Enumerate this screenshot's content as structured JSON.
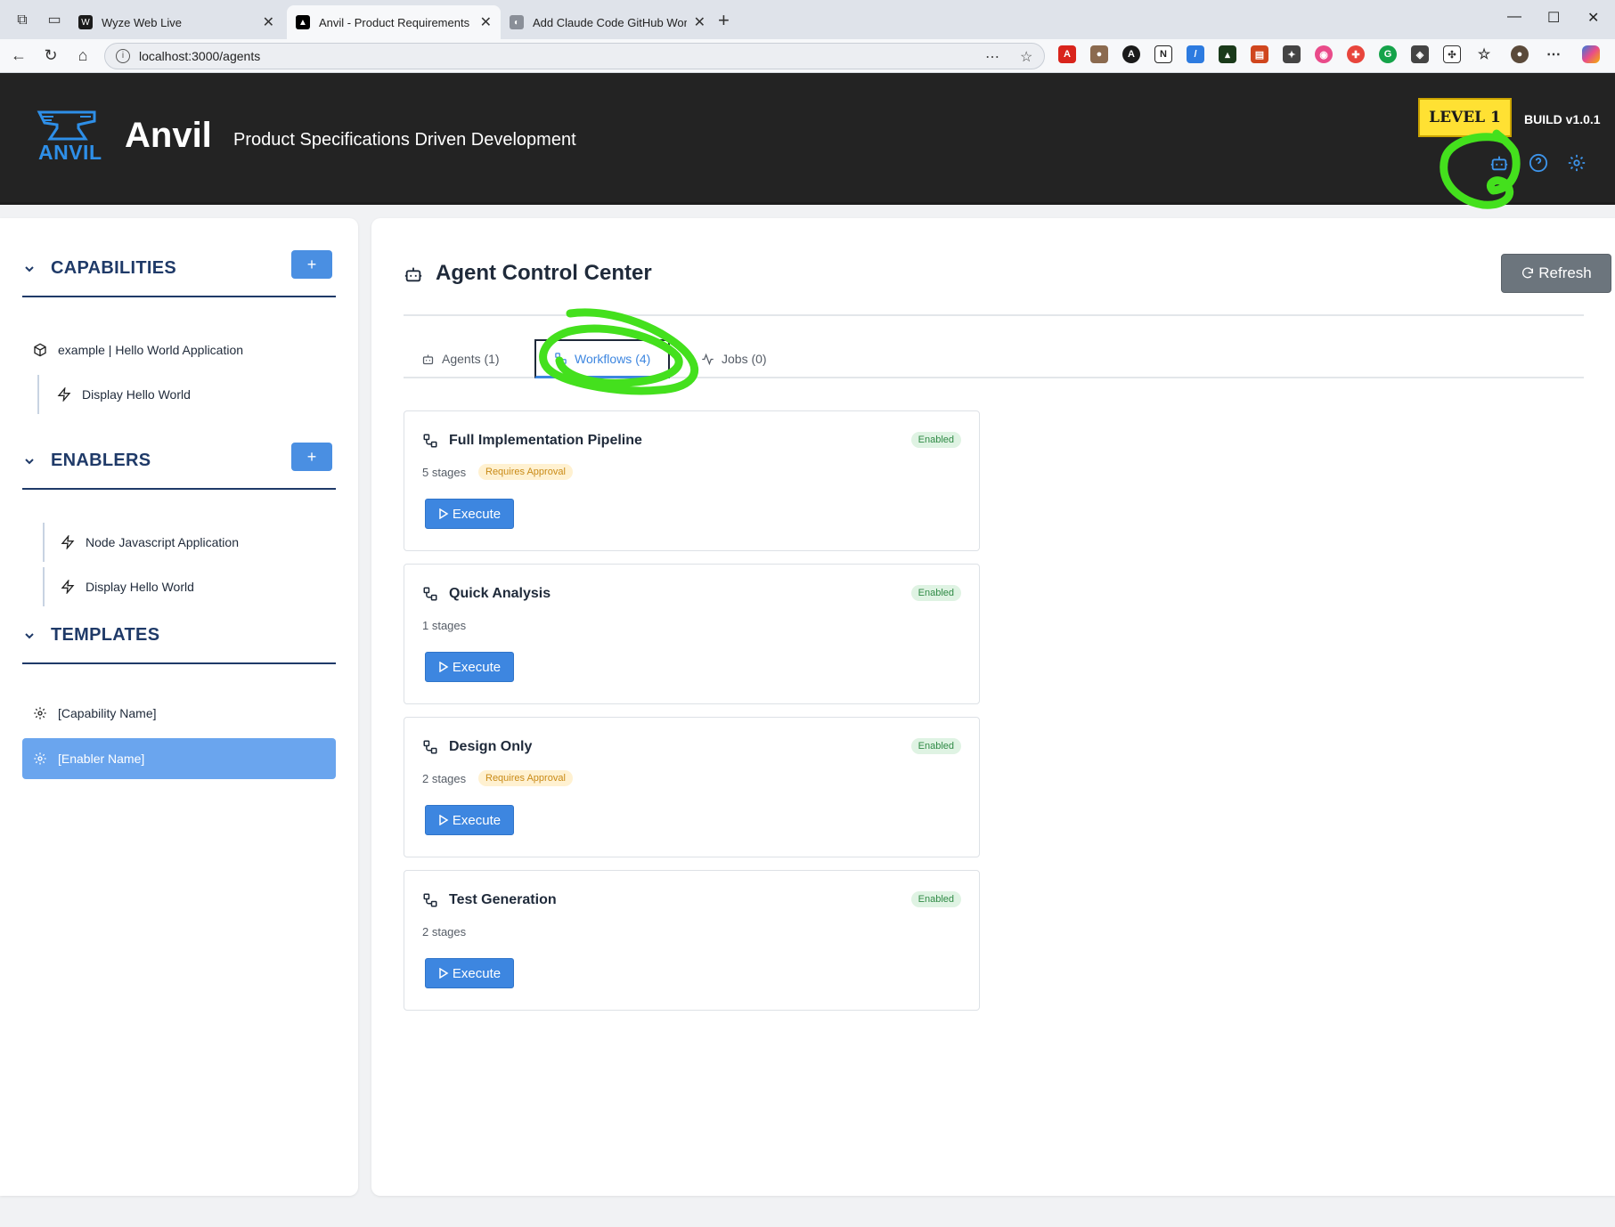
{
  "browser": {
    "tabs": [
      {
        "title": "Wyze Web Live",
        "favicon": "W",
        "color": "#1b1b1b"
      },
      {
        "title": "Anvil - Product Requirements Ma",
        "favicon": "▲",
        "color": "#000000"
      },
      {
        "title": "Add Claude Code GitHub Workflo",
        "favicon": "◐",
        "color": "#8a8f98"
      }
    ],
    "url": "localhost:3000/agents"
  },
  "header": {
    "logo_text": "ANVIL",
    "title": "Anvil",
    "subtitle": "Product Specifications Driven Development",
    "level": "LEVEL 1",
    "build": "BUILD v1.0.1",
    "accent": "#3d94ea",
    "level_color": "#ffe133"
  },
  "sidebar": {
    "capabilities": {
      "title": "CAPABILITIES",
      "add": "+",
      "items": [
        "example | Hello World Application",
        "Display Hello World"
      ]
    },
    "enablers": {
      "title": "ENABLERS",
      "add": "+",
      "items": [
        "Node Javascript Application",
        "Display Hello World"
      ]
    },
    "templates": {
      "title": "TEMPLATES",
      "items": [
        "[Capability Name]",
        "[Enabler Name]"
      ]
    }
  },
  "main": {
    "title": "Agent Control Center",
    "refresh": "Refresh",
    "tabs": [
      {
        "label": "Agents (1)",
        "icon": "robot-icon"
      },
      {
        "label": "Workflows (4)",
        "icon": "workflow-icon"
      },
      {
        "label": "Jobs (0)",
        "icon": "activity-icon"
      }
    ],
    "workflows": [
      {
        "name": "Full Implementation Pipeline",
        "status": "Enabled",
        "stages": "5 stages",
        "approval": "Requires Approval",
        "action": "Execute"
      },
      {
        "name": "Quick Analysis",
        "status": "Enabled",
        "stages": "1 stages",
        "approval": "",
        "action": "Execute"
      },
      {
        "name": "Design Only",
        "status": "Enabled",
        "stages": "2 stages",
        "approval": "Requires Approval",
        "action": "Execute"
      },
      {
        "name": "Test Generation",
        "status": "Enabled",
        "stages": "2 stages",
        "approval": "",
        "action": "Execute"
      }
    ]
  }
}
